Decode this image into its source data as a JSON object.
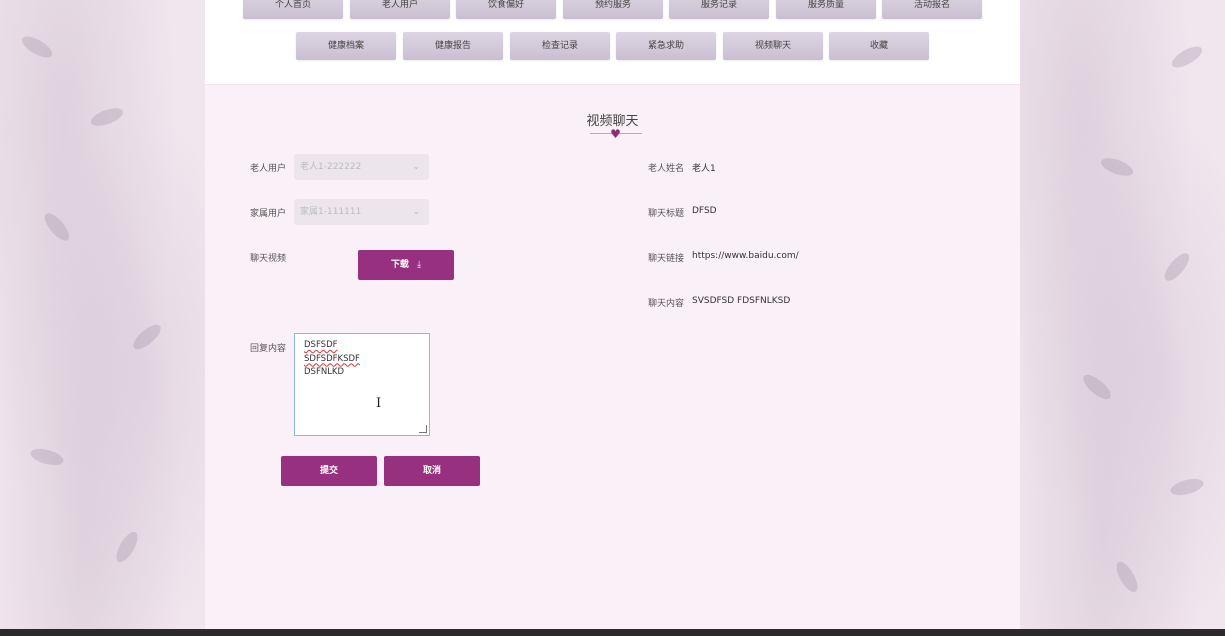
{
  "nav": {
    "row1": [
      "个人首页",
      "老人用户",
      "饮食偏好",
      "预约服务",
      "服务记录",
      "服务质量",
      "活动报名"
    ],
    "row2": [
      "健康档案",
      "健康报告",
      "检查记录",
      "紧急求助",
      "视频聊天",
      "收藏"
    ]
  },
  "page": {
    "title": "视频聊天"
  },
  "form": {
    "elder_user": {
      "label": "老人用户",
      "value": "老人1-222222"
    },
    "family_user": {
      "label": "家属用户",
      "value": "家属1-111111"
    },
    "chat_video": {
      "label": "聊天视频",
      "download_label": "下载"
    },
    "reply": {
      "label": "回复内容",
      "lines": [
        "DSFSDF",
        "SDFSDFKSDF",
        "DSFNLKD"
      ]
    },
    "submit_label": "提交",
    "cancel_label": "取消"
  },
  "info": {
    "elder_name": {
      "label": "老人姓名",
      "value": "老人1"
    },
    "chat_title": {
      "label": "聊天标题",
      "value": "DFSD"
    },
    "chat_link": {
      "label": "聊天链接",
      "value": "https://www.baidu.com/"
    },
    "chat_content": {
      "label": "聊天内容",
      "value": "SVSDFSD FDSFNLKSD"
    }
  },
  "colors": {
    "accent": "#97307f",
    "background": "#faf0f7"
  },
  "icons": {
    "download": "download-icon",
    "dropdown": "chevron-down-icon",
    "cursor": "text-cursor-icon"
  }
}
